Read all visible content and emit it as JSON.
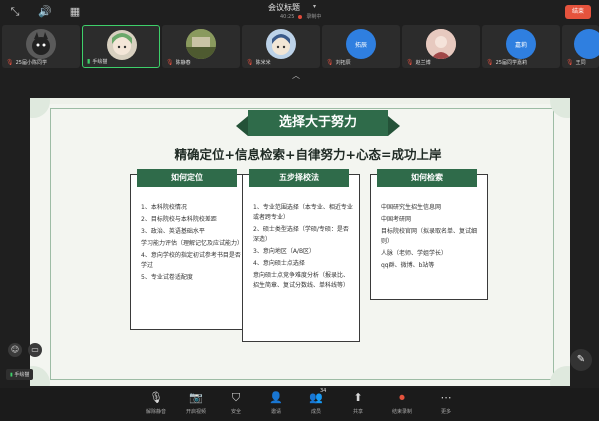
{
  "topbar": {
    "meeting_title": "会议标题",
    "timer": "40:25",
    "record_status": "录制中",
    "end_button": "结束"
  },
  "participants": [
    {
      "name": "25届小陈同学",
      "mic_muted": true,
      "avatar_color": "#5a5a5a"
    },
    {
      "name": "手绘猫",
      "mic_muted": false,
      "avatar_color": "#d8d0c0",
      "active": true
    },
    {
      "name": "陈静春",
      "mic_muted": true,
      "avatar_color": "#6d7a4e"
    },
    {
      "name": "陈米米",
      "mic_muted": true,
      "avatar_color": "#bcd2e8"
    },
    {
      "name": "刘拓辰",
      "mic_muted": true,
      "avatar_color": "#2f7fe0",
      "avatar_text": "拓辰"
    },
    {
      "name": "赵兰博",
      "mic_muted": true,
      "avatar_color": "#caa39a"
    },
    {
      "name": "25届同学嘉莉",
      "mic_muted": true,
      "avatar_color": "#2f7fe0",
      "avatar_text": "嘉莉"
    },
    {
      "name": "王同",
      "mic_muted": true,
      "avatar_color": "#2f7fe0"
    }
  ],
  "slide": {
    "banner": "选择大于努力",
    "slogan": "精确定位+信息检索+自律努力+心态=成功上岸",
    "cards": [
      {
        "title": "如何定位",
        "items": [
          "1、本科院校情况",
          "2、目标院校与本科院校差距",
          "3、政治、英语基础水平",
          "学习能力评估（理解记忆及应试能力）",
          "4、意向学校的指定初试参考书目是否学过",
          "5、专业试卷适配度"
        ]
      },
      {
        "title": "五步择校法",
        "items": [
          "1、专业范围选择（本专业、相近专业或者跨专业）",
          "2、硕士类型选择（学硕/专硕：是否深造）",
          "3、意向地区（A/B区）",
          "4、意向硕士点选择",
          "意向硕士点竞争难度分析（报录比、招生简章、复试分数线、单科线等）"
        ]
      },
      {
        "title": "如何检索",
        "items": [
          "中国研究生招生信息网",
          "中国考研网",
          "目标院校官网（拟录取名单、复试细则）",
          "人脉（老师、学姐学长）",
          "qq群、微博、b站等"
        ]
      }
    ]
  },
  "self_label": "手绘猫",
  "toolbar": [
    {
      "label": "解除静音",
      "icon": "mic-off-icon",
      "glyph": "🎙"
    },
    {
      "label": "开启视频",
      "icon": "camera-off-icon",
      "glyph": "📷"
    },
    {
      "label": "安全",
      "icon": "shield-icon",
      "glyph": "⛉"
    },
    {
      "label": "邀请",
      "icon": "invite-icon",
      "glyph": "👤"
    },
    {
      "label": "成员",
      "icon": "members-icon",
      "glyph": "👥",
      "count": "34"
    },
    {
      "label": "共享",
      "icon": "share-icon",
      "glyph": "⬆"
    },
    {
      "label": "结束录制",
      "icon": "record-stop-icon",
      "glyph": "⏺",
      "red": true
    },
    {
      "label": "更多",
      "icon": "more-icon",
      "glyph": "⋯"
    }
  ]
}
